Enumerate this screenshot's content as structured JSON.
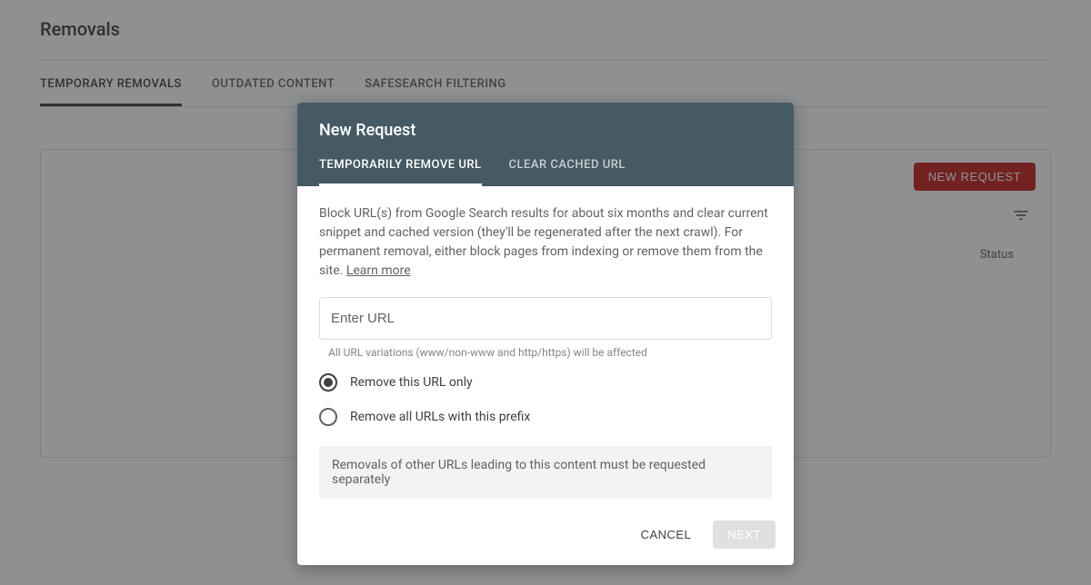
{
  "page": {
    "title": "Removals",
    "tabs": [
      {
        "label": "TEMPORARY REMOVALS",
        "active": true
      },
      {
        "label": "OUTDATED CONTENT",
        "active": false
      },
      {
        "label": "SAFESEARCH FILTERING",
        "active": false
      }
    ],
    "new_request_button": "NEW REQUEST",
    "table": {
      "columns": {
        "status": "Status"
      }
    }
  },
  "dialog": {
    "title": "New Request",
    "tabs": [
      {
        "label": "TEMPORARILY REMOVE URL",
        "active": true
      },
      {
        "label": "CLEAR CACHED URL",
        "active": false
      }
    ],
    "description_main": "Block URL(s) from Google Search results for about six months and clear current snippet and cached version (they'll be regenerated after the next crawl). For permanent removal, either block pages from indexing or remove them from the site. ",
    "description_link": "Learn more",
    "url_input": {
      "placeholder": "Enter URL",
      "value": ""
    },
    "url_hint": "All URL variations (www/non-www and http/https) will be affected",
    "radio_options": [
      {
        "label": "Remove this URL only",
        "selected": true
      },
      {
        "label": "Remove all URLs with this prefix",
        "selected": false
      }
    ],
    "info_banner": "Removals of other URLs leading to this content must be requested separately",
    "buttons": {
      "cancel": "CANCEL",
      "next": "NEXT"
    }
  }
}
